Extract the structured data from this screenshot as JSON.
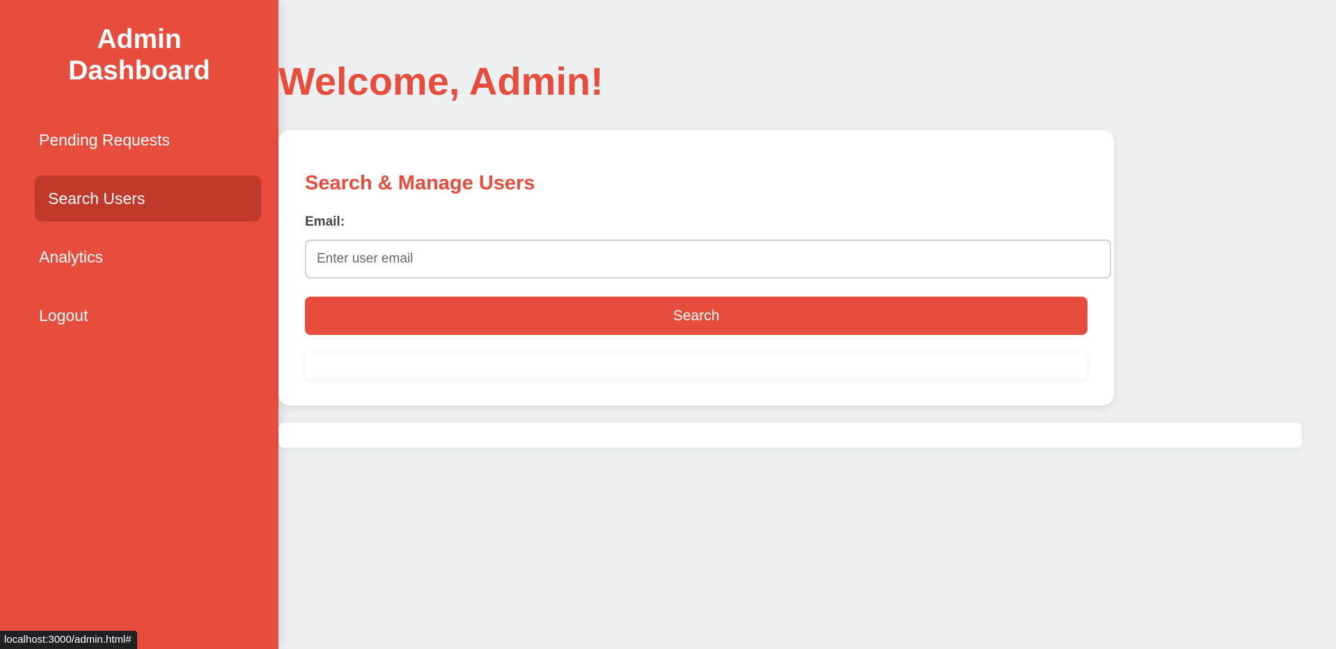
{
  "sidebar": {
    "title_line1": "Admin",
    "title_line2": "Dashboard",
    "items": [
      {
        "label": "Pending Requests",
        "active": false
      },
      {
        "label": "Search Users",
        "active": true
      },
      {
        "label": "Analytics",
        "active": false
      },
      {
        "label": "Logout",
        "active": false
      }
    ]
  },
  "main": {
    "welcome": "Welcome, Admin!",
    "search_card": {
      "title": "Search & Manage Users",
      "email_label": "Email:",
      "email_value": "",
      "email_placeholder": "Enter user email",
      "search_label": "Search"
    }
  },
  "status_bar": {
    "url": "localhost:3000/admin.html#"
  },
  "colors": {
    "accent": "#e74c3c",
    "accent_dark": "#c0392b",
    "background": "#ecf0f1"
  }
}
